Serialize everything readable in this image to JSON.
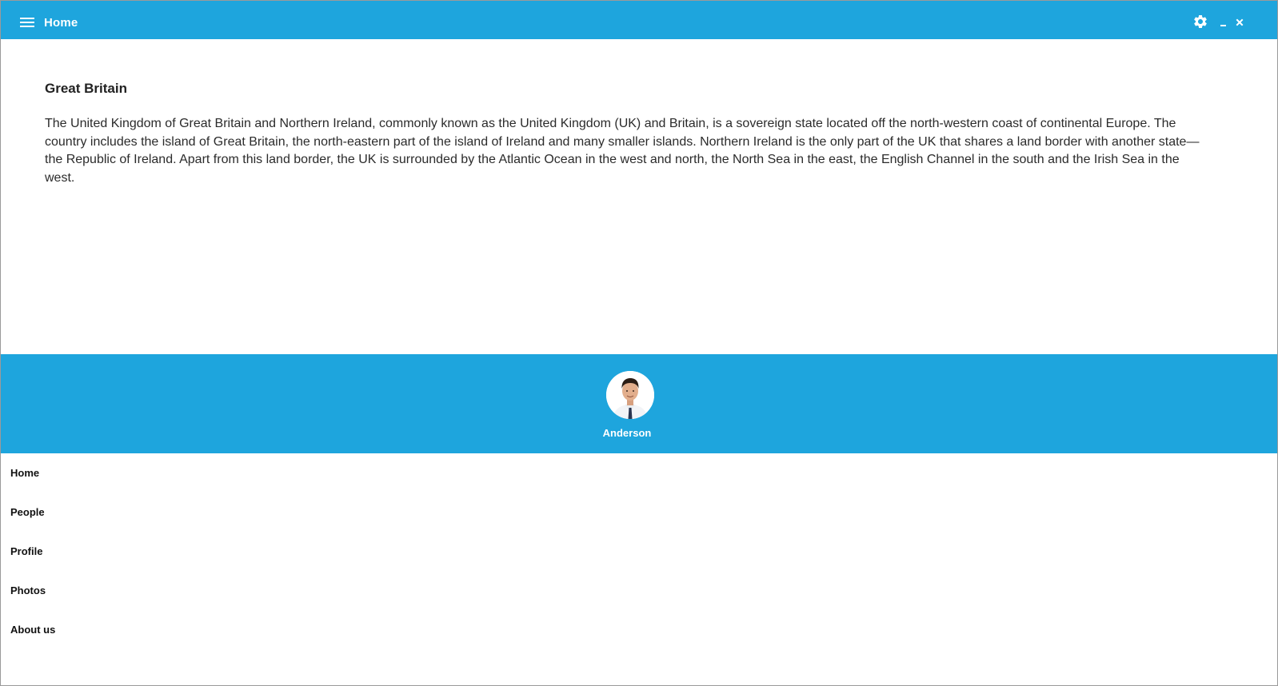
{
  "titlebar": {
    "title": "Home",
    "menu_icon": "hamburger-menu-icon",
    "settings_icon": "gear-icon",
    "minimize_icon": "minimize-icon",
    "close_icon": "close-icon",
    "close_glyph": "×"
  },
  "article": {
    "heading": "Great Britain",
    "body": "The United Kingdom of Great Britain and Northern Ireland, commonly known as the United Kingdom (UK) and Britain, is a sovereign state located off the north-western coast of continental Europe. The country includes the island of Great Britain, the north-eastern part of the island of Ireland and many smaller islands. Northern Ireland is the only part of the UK that shares a land border with another state—the Republic of Ireland. Apart from this land border, the UK is surrounded by the Atlantic Ocean in the west and north, the North Sea in the east, the English Channel in the south and the Irish Sea in the west."
  },
  "drawer": {
    "user_name": "Anderson",
    "items": [
      {
        "label": "Home"
      },
      {
        "label": "People"
      },
      {
        "label": "Profile"
      },
      {
        "label": "Photos"
      },
      {
        "label": "About us"
      }
    ]
  },
  "colors": {
    "accent": "#1ea5dd",
    "text": "#2b2b2b",
    "background": "#ffffff"
  }
}
